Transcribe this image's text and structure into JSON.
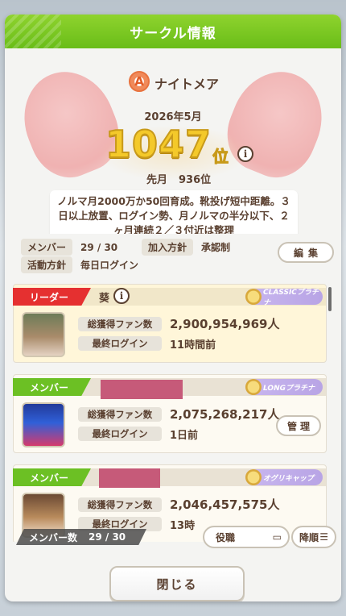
{
  "title": "サークル情報",
  "circle": {
    "rank_letter": "A",
    "name": "ナイトメア",
    "month": "2026年5月",
    "rank": "1047",
    "rank_suffix": "位",
    "last_month_label": "先月",
    "last_month_rank": "936位",
    "description": "ノルマ月2000万か50回育成。靴投げ短中距離。３日以上放置、ログイン勢、月ノルマの半分以下、２ヶ月連続２／３付近は整理"
  },
  "fields": {
    "members_label": "メンバー",
    "members_value": "29 / 30",
    "join_label": "加入方針",
    "join_value": "承認制",
    "activity_label": "活動方針",
    "activity_value": "毎日ログイン",
    "edit_label": "編集"
  },
  "members": [
    {
      "role": "リーダー",
      "name": "葵",
      "rank_chip": "CLASSICプラチナ",
      "fans_label": "総獲得ファン数",
      "fans": "2,900,954,969人",
      "login_label": "最終ログイン",
      "login": "11時間前"
    },
    {
      "role": "メンバー",
      "name": "",
      "rank_chip": "LONGプラチナ",
      "fans_label": "総獲得ファン数",
      "fans": "2,075,268,217人",
      "login_label": "最終ログイン",
      "login": "1日前",
      "manage_label": "管理"
    },
    {
      "role": "メンバー",
      "name": "",
      "rank_chip": "オグリキャップ",
      "fans_label": "総獲得ファン数",
      "fans": "2,046,457,575人",
      "login_label": "最終ログイン",
      "login": "13時"
    }
  ],
  "footer": {
    "count_label": "メンバー数",
    "count_value": "29 / 30",
    "role_button": "役職",
    "sort_button": "降順",
    "close_button": "閉じる"
  },
  "colors": {
    "title_bar": "#7cc823",
    "leader_tag": "#e53030",
    "member_tag": "#6cc024",
    "text": "#5a4030",
    "rank_gold": "#f4c92a"
  },
  "icons": [
    "info-icon",
    "rank-a-icon",
    "edit-icon",
    "sort-icon",
    "chat-icon"
  ]
}
